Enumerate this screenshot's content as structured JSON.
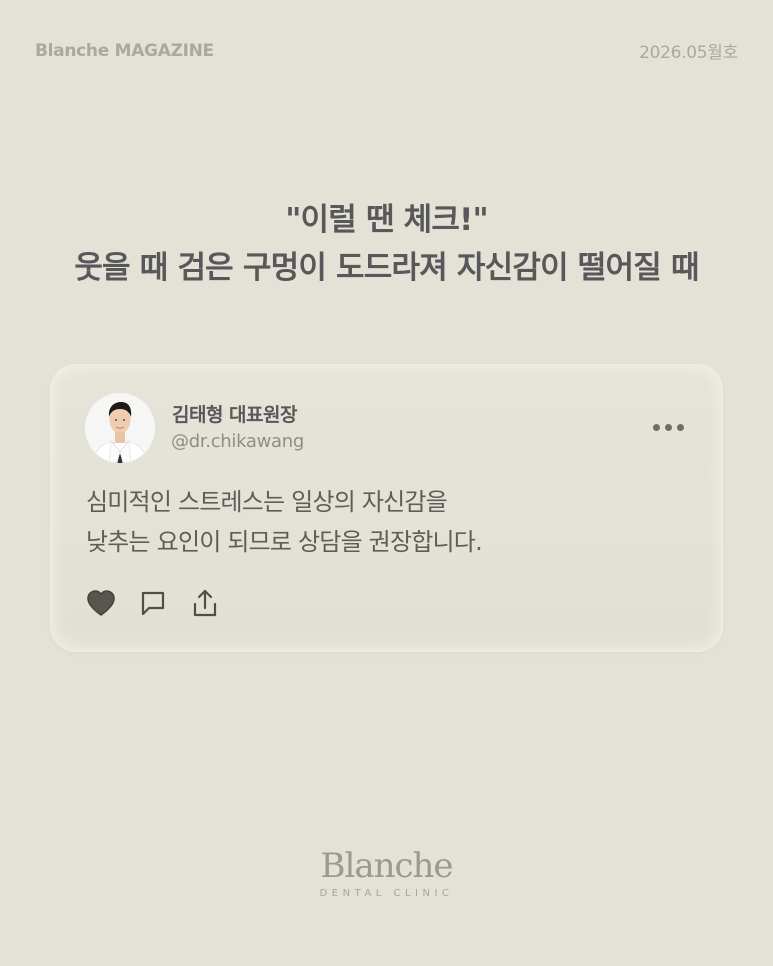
{
  "header": {
    "brand": "Blanche MAGAZINE",
    "issue": "2026.05월호"
  },
  "headline": {
    "line1": "\"이럴 땐 체크!\"",
    "line2": "웃을 때 검은 구멍이 도드라져 자신감이 떨어질 때"
  },
  "post": {
    "author_name": "김태형 대표원장",
    "author_handle": "@dr.chikawang",
    "text_line1": "심미적인 스트레스는 일상의 자신감을",
    "text_line2": "낮추는 요인이 되므로 상담을 권장합니다.",
    "liked": true,
    "icons": [
      "heart-icon",
      "comment-icon",
      "share-icon",
      "more-icon"
    ]
  },
  "footer": {
    "logo": "Blanche",
    "tagline": "DENTAL CLINIC"
  },
  "colors": {
    "background": "#e4e2d7",
    "text": "#58575a",
    "muted": "#a9a8a2"
  }
}
